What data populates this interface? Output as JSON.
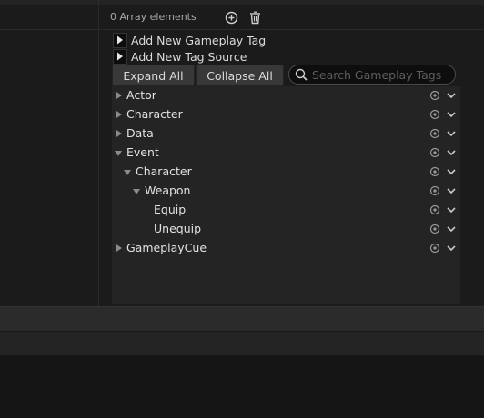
{
  "array": {
    "count_text": "0 Array elements",
    "add_icon": "add-circle-icon",
    "delete_icon": "trash-icon"
  },
  "actions": {
    "add_tag": "Add New Gameplay Tag",
    "add_source": "Add New Tag Source"
  },
  "buttons": {
    "expand": "Expand All",
    "collapse": "Collapse All"
  },
  "search": {
    "placeholder": "Search Gameplay Tags",
    "value": ""
  },
  "tags": [
    {
      "label": "Actor",
      "depth": 0,
      "state": "collapsed"
    },
    {
      "label": "Character",
      "depth": 0,
      "state": "collapsed"
    },
    {
      "label": "Data",
      "depth": 0,
      "state": "collapsed"
    },
    {
      "label": "Event",
      "depth": 0,
      "state": "expanded"
    },
    {
      "label": "Character",
      "depth": 1,
      "state": "expanded"
    },
    {
      "label": "Weapon",
      "depth": 2,
      "state": "expanded"
    },
    {
      "label": "Equip",
      "depth": 3,
      "state": "leaf"
    },
    {
      "label": "Unequip",
      "depth": 3,
      "state": "leaf"
    },
    {
      "label": "GameplayCue",
      "depth": 0,
      "state": "collapsed"
    }
  ],
  "colors": {
    "background": "#151515",
    "panel": "#1b1b1b",
    "tree_bg": "#242424",
    "button": "#383838",
    "text": "#e2e2e2"
  }
}
